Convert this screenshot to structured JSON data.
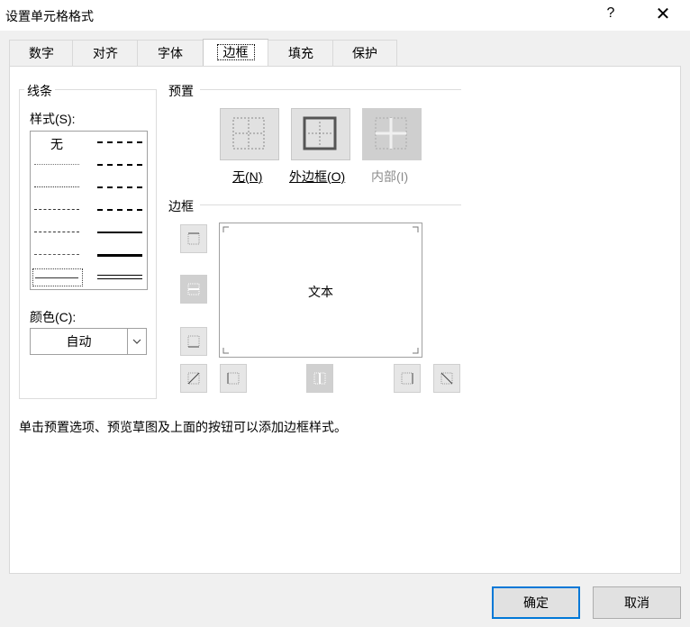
{
  "window": {
    "title": "设置单元格格式",
    "help_glyph": "?",
    "close_glyph": "✕"
  },
  "tabs": [
    {
      "label": "数字"
    },
    {
      "label": "对齐"
    },
    {
      "label": "字体"
    },
    {
      "label": "边框",
      "active": true
    },
    {
      "label": "填充"
    },
    {
      "label": "保护"
    }
  ],
  "line_group": {
    "title": "线条",
    "style_label": "样式(S):",
    "none_label": "无",
    "color_label": "颜色(C):",
    "color_value": "自动"
  },
  "presets": {
    "title": "预置",
    "none_label": "无(N)",
    "outline_label": "外边框(O)",
    "inside_label": "内部(I)"
  },
  "border": {
    "title": "边框",
    "preview_text": "文本"
  },
  "hint": "单击预置选项、预览草图及上面的按钮可以添加边框样式。",
  "footer": {
    "ok_label": "确定",
    "cancel_label": "取消"
  },
  "colors": {
    "accent": "#0078d7",
    "panel_bg": "#ffffff",
    "dialog_bg": "#f0f0f0",
    "disabled_text": "#8c8c8c"
  }
}
